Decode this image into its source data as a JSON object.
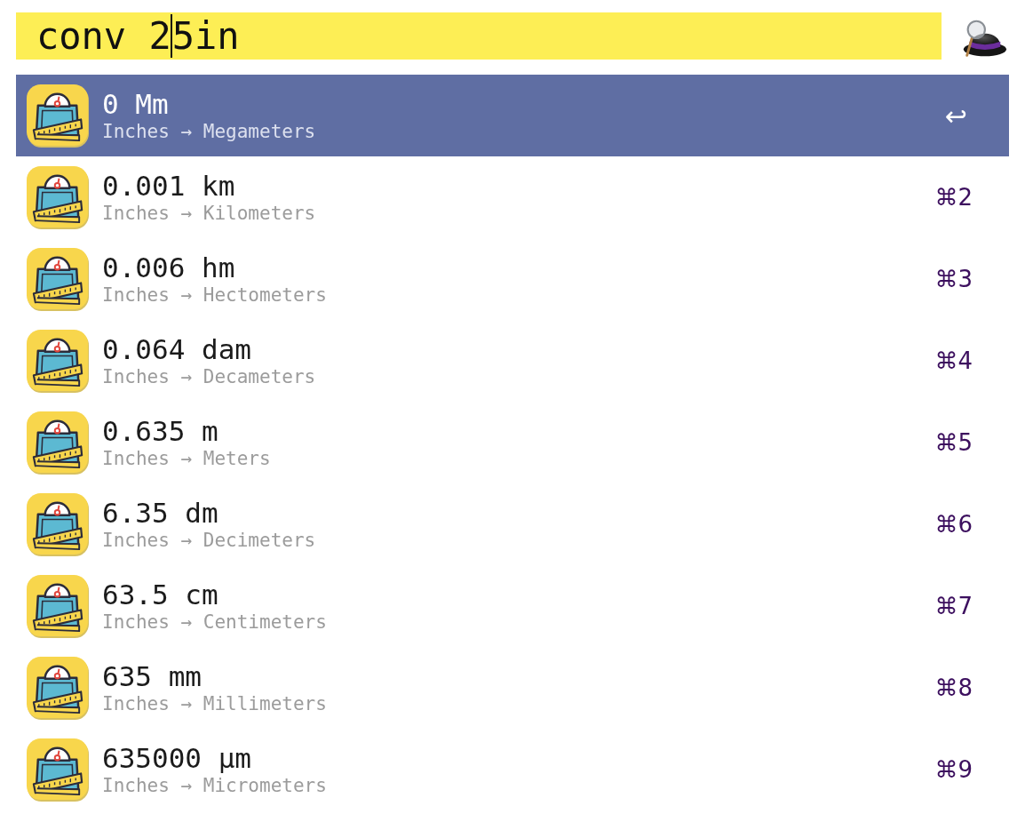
{
  "search": {
    "value_before_caret": "conv 2",
    "value_after_caret": "5in"
  },
  "results": [
    {
      "title": "0 Mm",
      "subtitle": "Inches → Megameters",
      "shortcut": "↩",
      "selected": true
    },
    {
      "title": "0.001 km",
      "subtitle": "Inches → Kilometers",
      "shortcut": "⌘2",
      "selected": false
    },
    {
      "title": "0.006 hm",
      "subtitle": "Inches → Hectometers",
      "shortcut": "⌘3",
      "selected": false
    },
    {
      "title": "0.064 dam",
      "subtitle": "Inches → Decameters",
      "shortcut": "⌘4",
      "selected": false
    },
    {
      "title": "0.635 m",
      "subtitle": "Inches → Meters",
      "shortcut": "⌘5",
      "selected": false
    },
    {
      "title": "6.35 dm",
      "subtitle": "Inches → Decimeters",
      "shortcut": "⌘6",
      "selected": false
    },
    {
      "title": "63.5 cm",
      "subtitle": "Inches → Centimeters",
      "shortcut": "⌘7",
      "selected": false
    },
    {
      "title": "635 mm",
      "subtitle": "Inches → Millimeters",
      "shortcut": "⌘8",
      "selected": false
    },
    {
      "title": "635000 µm",
      "subtitle": "Inches → Micrometers",
      "shortcut": "⌘9",
      "selected": false
    }
  ]
}
